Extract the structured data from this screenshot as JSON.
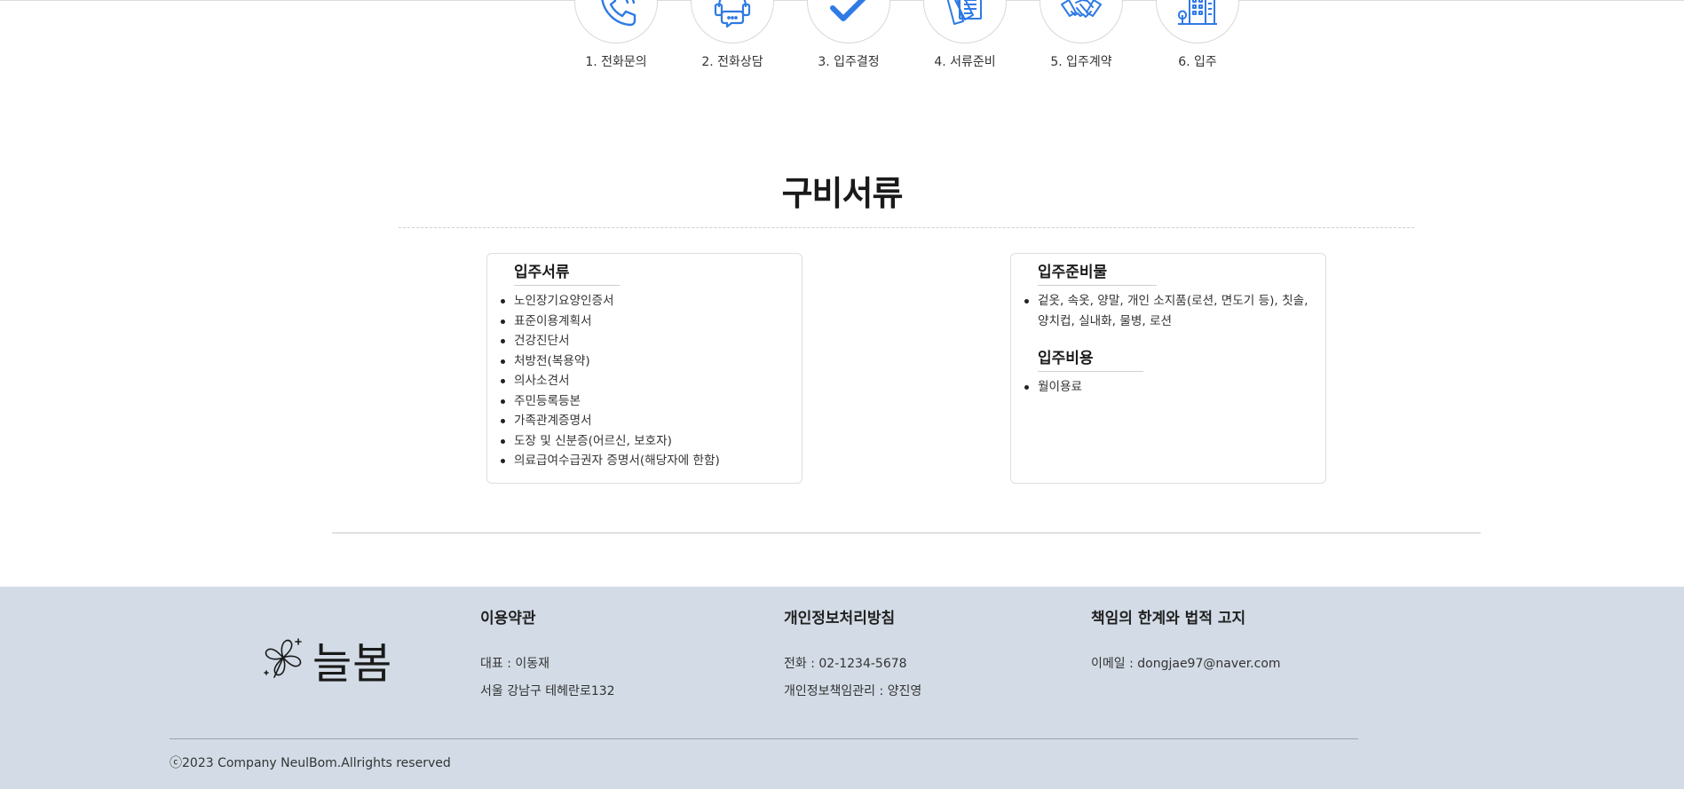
{
  "steps": [
    {
      "label": "1. 전화문의",
      "icon": "phone-icon"
    },
    {
      "label": "2. 전화상담",
      "icon": "headset-chat-icon"
    },
    {
      "label": "3. 입주결정",
      "icon": "checkmark-icon"
    },
    {
      "label": "4. 서류준비",
      "icon": "documents-icon"
    },
    {
      "label": "5. 입주계약",
      "icon": "handshake-icon"
    },
    {
      "label": "6. 입주",
      "icon": "building-icon"
    }
  ],
  "colors": {
    "accent": "#2f7ae5",
    "footer_bg": "#d3dce6"
  },
  "section": {
    "title": "구비서류"
  },
  "documents_card": {
    "heading": "입주서류",
    "items": [
      "노인장기요양인증서",
      "표준이용계획서",
      "건강진단서",
      "처방전(복용약)",
      "의사소견서",
      "주민등록등본",
      "가족관계증명서",
      "도장 및 신분증(어르신, 보호자)",
      "의료급여수급권자 증명서(해당자에 한함)"
    ]
  },
  "supplies_card": {
    "heading": "입주준비물",
    "items": [
      "겉옷, 속옷, 양말, 개인 소지품(로션, 면도기 등), 칫솔, 양치컵, 실내화, 물병, 로션"
    ],
    "cost_heading": "입주비용",
    "cost_items": [
      "월이용료"
    ]
  },
  "footer": {
    "logo_text": "늘봄",
    "col1": {
      "heading": "이용약관",
      "line1": "대표 : 이동재",
      "line2": "서울 강남구 테헤란로132"
    },
    "col2": {
      "heading": "개인정보처리방침",
      "line1": "전화 : 02-1234-5678",
      "line2": "개인정보책임관리 : 양진영"
    },
    "col3": {
      "heading": "책임의 한계와 법적 고지",
      "line1": "이메일 : dongjae97@naver.com"
    },
    "copyright": "ⓒ2023 Company NeulBom.Allrights reserved"
  }
}
